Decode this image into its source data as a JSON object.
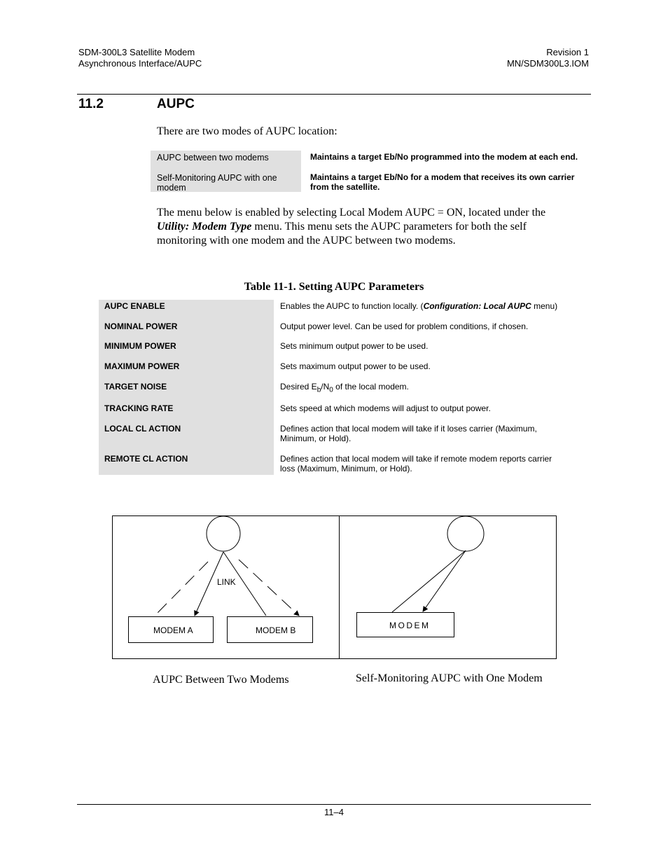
{
  "header": {
    "left_line1": "SDM-300L3 Satellite Modem",
    "left_line2": "Asynchronous Interface/AUPC",
    "right_line1": "Revision 1",
    "right_line2": "MN/SDM300L3.IOM"
  },
  "section": {
    "number": "11.2",
    "title": "AUPC"
  },
  "intro": "There are two modes of AUPC location:",
  "modes": [
    {
      "name": "AUPC between two modems",
      "description": "Maintains a target Eb/No programmed into the modem at each end."
    },
    {
      "name_line1": "Self-Monitoring AUPC with one",
      "name_line2": "modem",
      "description_line1": "Maintains a target Eb/No for a modem that receives its own carrier",
      "description_line2": "from the satellite."
    }
  ],
  "paragraph": {
    "line1": "The menu below is enabled by selecting Local Modem AUPC = ON, located under the",
    "line2_emph": "Utility: Modem Type",
    "line2_rest": " menu. This menu sets the AUPC parameters for both the self",
    "line3": "monitoring with one modem and the AUPC between two modems."
  },
  "table": {
    "caption": "Table 11-1.  Setting AUPC Parameters",
    "rows": [
      {
        "param": "AUPC ENABLE",
        "desc_pre": "Enables the AUPC to function locally. (",
        "desc_emph": "Configuration: Local AUPC",
        "desc_post": " menu)"
      },
      {
        "param": "NOMINAL POWER",
        "desc": "Output power level. Can be used for problem conditions, if chosen."
      },
      {
        "param": "MINIMUM POWER",
        "desc": "Sets minimum output power to be used."
      },
      {
        "param": "MAXIMUM POWER",
        "desc": "Sets maximum output power to be used."
      },
      {
        "param": "TARGET NOISE",
        "desc_pre": "Desired E",
        "sub1": "b",
        "mid": "/N",
        "sub2": "0",
        "desc_post": " of the local modem."
      },
      {
        "param": "TRACKING RATE",
        "desc": "Sets speed at which modems will adjust to output power."
      },
      {
        "param": "LOCAL CL ACTION",
        "desc_line1": "Defines action that local modem will take if it loses carrier (Maximum,",
        "desc_line2": "Minimum, or Hold)."
      },
      {
        "param": "REMOTE CL ACTION",
        "desc_line1": "Defines action that local modem will take if remote modem reports carrier",
        "desc_line2": "loss (Maximum, Minimum, or Hold)."
      }
    ]
  },
  "diagram": {
    "left": {
      "link_label": "LINK",
      "modem_a": "MODEM A",
      "modem_b": "MODEM B",
      "caption": "AUPC Between Two Modems"
    },
    "right": {
      "modem": "MODEM",
      "caption": "Self-Monitoring AUPC with One Modem"
    }
  },
  "footer": {
    "page": "11–4"
  }
}
